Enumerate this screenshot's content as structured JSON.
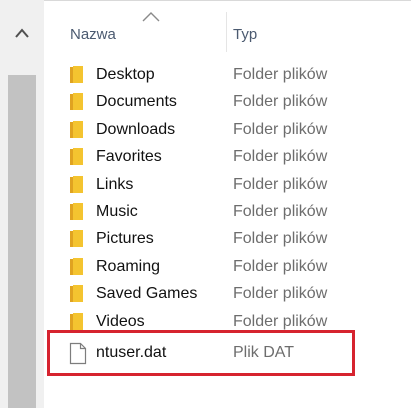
{
  "columns": {
    "name": "Nazwa",
    "type": "Typ"
  },
  "folders": [
    {
      "name": "Desktop",
      "type": "Folder plików"
    },
    {
      "name": "Documents",
      "type": "Folder plików"
    },
    {
      "name": "Downloads",
      "type": "Folder plików"
    },
    {
      "name": "Favorites",
      "type": "Folder plików"
    },
    {
      "name": "Links",
      "type": "Folder plików"
    },
    {
      "name": "Music",
      "type": "Folder plików"
    },
    {
      "name": "Pictures",
      "type": "Folder plików"
    },
    {
      "name": "Roaming",
      "type": "Folder plików"
    },
    {
      "name": "Saved Games",
      "type": "Folder plików"
    },
    {
      "name": "Videos",
      "type": "Folder plików"
    }
  ],
  "file": {
    "name": "ntuser.dat",
    "type": "Plik DAT"
  },
  "colors": {
    "highlight": "#d6232f",
    "folder": "#f4c430"
  }
}
